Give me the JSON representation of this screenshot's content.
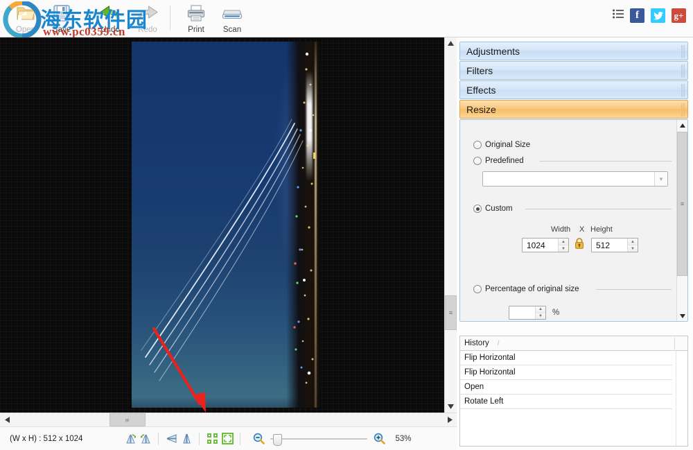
{
  "toolbar": {
    "buttons": [
      {
        "label": "Open",
        "icon": "folder-open-icon",
        "disabled": true
      },
      {
        "label": "Save",
        "icon": "floppy-disk-icon",
        "disabled": false
      },
      {
        "label": "Undo",
        "icon": "undo-arrow-icon",
        "disabled": false
      },
      {
        "label": "Redo",
        "icon": "redo-arrow-icon",
        "disabled": true
      },
      {
        "label": "Print",
        "icon": "printer-icon",
        "disabled": false
      },
      {
        "label": "Scan",
        "icon": "scanner-icon",
        "disabled": false
      }
    ],
    "right_icons": [
      {
        "name": "list-menu-icon",
        "label": "Menu"
      },
      {
        "name": "facebook-icon",
        "label": "f",
        "color": "#3b5998"
      },
      {
        "name": "twitter-icon",
        "label": "t",
        "color": "#33ccff"
      },
      {
        "name": "googleplus-icon",
        "label": "g+",
        "color": "#cc4b3c"
      }
    ]
  },
  "watermark": {
    "chinese": "海东软件园",
    "url": "www.pc0359.cn"
  },
  "panel": {
    "accordion": [
      {
        "label": "Adjustments",
        "active": false
      },
      {
        "label": "Filters",
        "active": false
      },
      {
        "label": "Effects",
        "active": false
      },
      {
        "label": "Resize",
        "active": true
      }
    ],
    "resize": {
      "original_size_label": "Original Size",
      "original_size_selected": false,
      "predefined_label": "Predefined",
      "predefined_selected": false,
      "predefined_value": "",
      "custom_label": "Custom",
      "custom_selected": true,
      "width_label": "Width",
      "x_label": "X",
      "height_label": "Height",
      "width_value": "1024",
      "height_value": "512",
      "lock_icon": "padlock-locked-icon",
      "percentage_label": "Percentage of original size",
      "percentage_selected": false,
      "percentage_value": "",
      "percent_sign": "%"
    }
  },
  "history": {
    "title": "History",
    "separator": "/",
    "items": [
      {
        "label": "Flip Horizontal"
      },
      {
        "label": "Flip Horizontal"
      },
      {
        "label": "Open"
      },
      {
        "label": "Rotate Left"
      }
    ]
  },
  "statusbar": {
    "dimensions": "(W x H) : 512 x 1024",
    "tools": [
      {
        "name": "rotate-right-icon"
      },
      {
        "name": "rotate-left-icon"
      },
      {
        "name": "flip-vertical-icon"
      },
      {
        "name": "flip-horizontal-icon"
      },
      {
        "name": "tile-view-icon"
      },
      {
        "name": "fit-to-screen-icon"
      }
    ],
    "zoom_out_icon": "zoom-out-icon",
    "zoom_in_icon": "zoom-in-icon",
    "zoom_level": "53%"
  },
  "canvas": {
    "image_alt": "night-city-skyline-light-trails",
    "annotation": {
      "name": "red-arrow-annotation",
      "color": "#e8221c"
    }
  },
  "colors": {
    "accent_active": "#f9bc62",
    "accent_header": "#c8ddf4",
    "canvas_bg": "#000000"
  }
}
